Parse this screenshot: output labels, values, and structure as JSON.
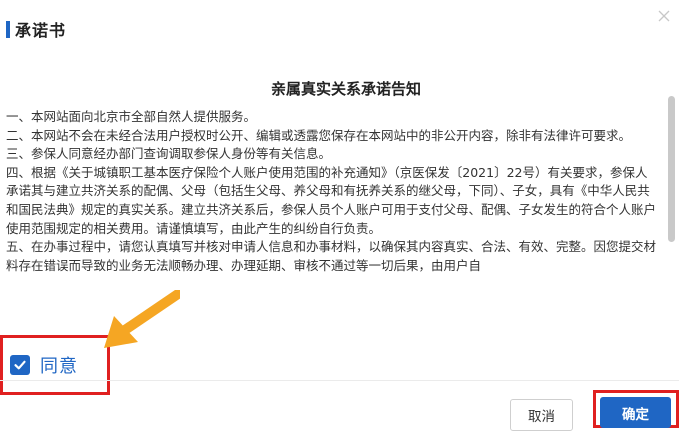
{
  "dialog": {
    "title": "承诺书",
    "close_icon": "close-icon",
    "notice_title": "亲属真实关系承诺告知",
    "paragraphs": [
      "一、本网站面向北京市全部自然人提供服务。",
      "二、本网站不会在未经合法用户授权时公开、编辑或透露您保存在本网站中的非公开内容，除非有法律许可要求。",
      "三、参保人同意经办部门查询调取参保人身份等有关信息。",
      "四、根据《关于城镇职工基本医疗保险个人账户使用范围的补充通知》（京医保发〔2021〕22号）有关要求，参保人承诺其与建立共济关系的配偶、父母（包括生父母、养父母和有抚养关系的继父母，下同）、子女，具有《中华人民共和国民法典》规定的真实关系。建立共济关系后，参保人员个人账户可用于支付父母、配偶、子女发生的符合个人账户使用范围规定的相关费用。请谨慎填写，由此产生的纠纷自行负责。",
      "五、在办事过程中，请您认真填写并核对申请人信息和办事材料，以确保其内容真实、合法、有效、完整。因您提交材料存在错误而导致的业务无法顺畅办理、办理延期、审核不通过等一切后果，由用户自"
    ],
    "agree_label": "同意",
    "agree_checked": true,
    "cancel_label": "取消",
    "confirm_label": "确定",
    "colors": {
      "accent": "#1f66c4",
      "highlight": "#e02020",
      "arrow": "#f5a623"
    }
  }
}
